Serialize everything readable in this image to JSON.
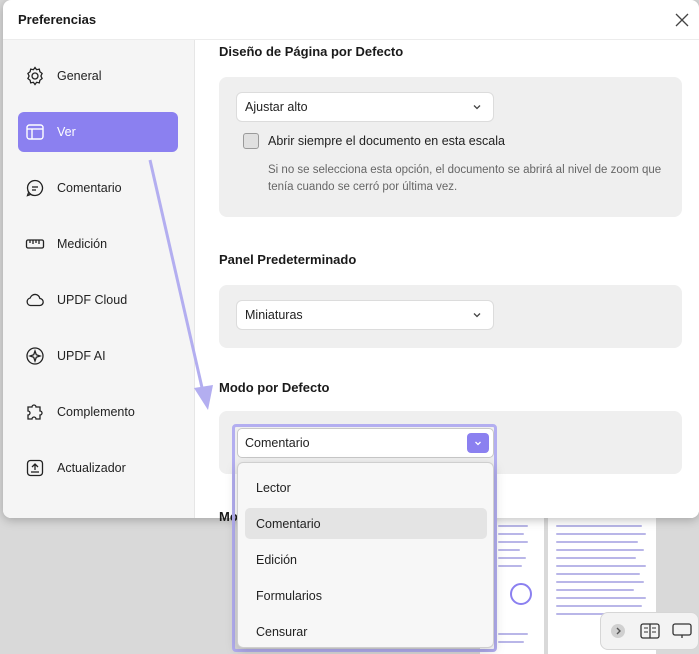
{
  "dialog": {
    "title": "Preferencias"
  },
  "sidebar": {
    "items": [
      {
        "label": "General",
        "icon": "gear-icon"
      },
      {
        "label": "Ver",
        "icon": "layout-icon",
        "active": true
      },
      {
        "label": "Comentario",
        "icon": "comment-icon"
      },
      {
        "label": "Medición",
        "icon": "ruler-icon"
      },
      {
        "label": "UPDF Cloud",
        "icon": "cloud-icon"
      },
      {
        "label": "UPDF AI",
        "icon": "ai-icon"
      },
      {
        "label": "Complemento",
        "icon": "puzzle-icon"
      },
      {
        "label": "Actualizador",
        "icon": "update-icon"
      }
    ]
  },
  "layout_section": {
    "title": "Diseño de Página por Defecto",
    "select_value": "Ajustar alto",
    "checkbox_label": "Abrir siempre el documento en esta escala",
    "checkbox_checked": false,
    "hint": "Si no se selecciona esta opción, el documento se abrirá al nivel de zoom que tenía cuando se cerró por última vez."
  },
  "panel_section": {
    "title": "Panel Predeterminado",
    "select_value": "Miniaturas"
  },
  "mode_section": {
    "title": "Modo por Defecto",
    "select_value": "Comentario",
    "options": [
      "Lector",
      "Comentario",
      "Edición",
      "Formularios",
      "Censurar"
    ],
    "hovered": "Comentario"
  },
  "next_section_partial": "Mo",
  "colors": {
    "accent": "#8b80f0",
    "highlight_frame": "#b3aef0"
  }
}
